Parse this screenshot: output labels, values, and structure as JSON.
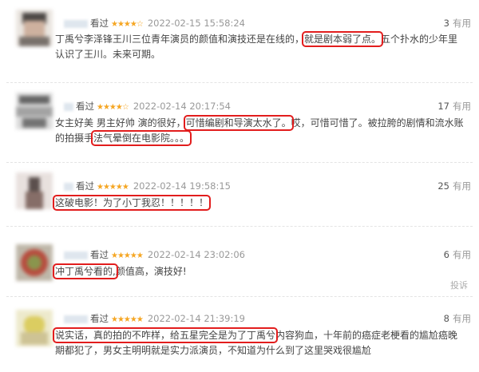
{
  "reviews": [
    {
      "action": "看过",
      "stars": "★★★★☆",
      "time": "2022-02-15 15:58:24",
      "useful_count": "3",
      "useful_label": "有用",
      "text_a": "丁禹兮李泽锋王川三位青年演员的颜值和演技还是在线的，",
      "text_hl": "就是剧本弱了点。",
      "text_b": "五个扑水的少年里认识了王川。未来可期。"
    },
    {
      "action": "看过",
      "stars": "★★★★☆",
      "time": "2022-02-14 20:17:54",
      "useful_count": "17",
      "useful_label": "有用",
      "text_a": "女主好美 男主好帅 演的很好，",
      "text_hl1": "可惜编剧和导演太水了。",
      "text_mid": "哎，可惜可惜了。被拉胯的剧情和流水账的拍摄手",
      "text_hl2": "法气晕倒在电影院。。。"
    },
    {
      "action": "看过",
      "stars": "★★★★★",
      "time": "2022-02-14 19:58:15",
      "useful_count": "25",
      "useful_label": "有用",
      "text_hl": "这破电影！为了小丁我忍！！！！！"
    },
    {
      "action": "看过",
      "stars": "★★★★★",
      "time": "2022-02-14 23:02:06",
      "useful_count": "6",
      "useful_label": "有用",
      "text_hl": "冲丁禹兮看的,",
      "text_b": "颜值高，演技好!",
      "report": "投诉"
    },
    {
      "action": "看过",
      "stars": "★★★★★",
      "time": "2022-02-14 21:39:19",
      "useful_count": "8",
      "useful_label": "有用",
      "text_hl": "说实话，真的拍的不咋样，给五星完全是为了丁禹兮",
      "text_b": "内容狗血，十年前的癌症老梗看的尴尬癌晚期都犯了，男女主明明就是实力派演员，不知道为什么到了这里哭戏很尴尬"
    }
  ],
  "colors": {
    "star": "#f5a623",
    "highlight": "#e21d1d"
  }
}
